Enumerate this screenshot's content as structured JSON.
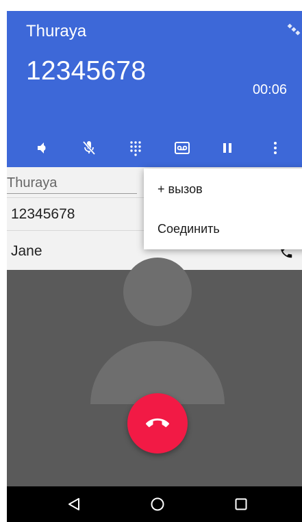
{
  "call": {
    "provider": "Thuraya",
    "number": "12345678",
    "timer": "00:06"
  },
  "controls": [
    {
      "icon": "speaker-icon"
    },
    {
      "icon": "mic-off-icon"
    },
    {
      "icon": "dialpad-icon"
    },
    {
      "icon": "voicemail-icon"
    },
    {
      "icon": "pause-icon"
    },
    {
      "icon": "more-vert-icon"
    }
  ],
  "contacts": {
    "title": "Thuraya",
    "number": "12345678",
    "name": "Jane"
  },
  "menu": {
    "add_call": "+ вызов",
    "merge": "Соединить"
  },
  "colors": {
    "header": "#3d68d8",
    "end_call": "#f21a45",
    "background": "#5a5a5a"
  }
}
